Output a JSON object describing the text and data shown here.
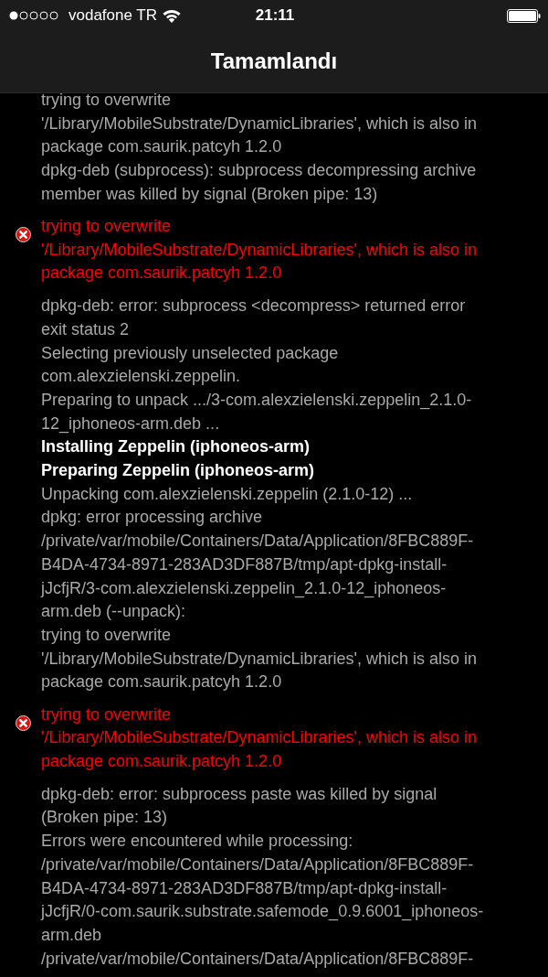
{
  "status_bar": {
    "carrier": "vodafone TR",
    "time": "21:11"
  },
  "nav_bar": {
    "title": "Tamamlandı"
  },
  "log": [
    {
      "kind": "normal",
      "lines": [
        "trying to overwrite",
        "'/Library/MobileSubstrate/DynamicLibraries', which is also in",
        "package com.saurik.patcyh 1.2.0"
      ]
    },
    {
      "kind": "normal",
      "lines": [
        "dpkg-deb (subprocess): subprocess decompressing archive",
        "member was killed by signal (Broken pipe: 13)"
      ]
    },
    {
      "kind": "error",
      "lines": [
        "trying to overwrite",
        "'/Library/MobileSubstrate/DynamicLibraries', which is also in",
        "package com.saurik.patcyh 1.2.0"
      ]
    },
    {
      "kind": "normal",
      "lines": [
        "dpkg-deb: error: subprocess <decompress> returned error",
        "exit status 2"
      ]
    },
    {
      "kind": "normal",
      "lines": [
        "Selecting previously unselected package",
        "com.alexzielenski.zeppelin."
      ]
    },
    {
      "kind": "normal",
      "lines": [
        "Preparing to unpack .../3-com.alexzielenski.zeppelin_2.1.0-",
        "12_iphoneos-arm.deb ..."
      ]
    },
    {
      "kind": "bold",
      "lines": [
        "Installing Zeppelin (iphoneos-arm)"
      ]
    },
    {
      "kind": "bold",
      "lines": [
        "Preparing Zeppelin (iphoneos-arm)"
      ]
    },
    {
      "kind": "normal",
      "lines": [
        "Unpacking com.alexzielenski.zeppelin (2.1.0-12) ..."
      ]
    },
    {
      "kind": "normal",
      "lines": [
        "dpkg: error processing archive",
        "/private/var/mobile/Containers/Data/Application/8FBC889F-",
        "B4DA-4734-8971-283AD3DF887B/tmp/apt-dpkg-install-",
        "jJcfjR/3-com.alexzielenski.zeppelin_2.1.0-12_iphoneos-",
        "arm.deb (--unpack):"
      ]
    },
    {
      "kind": "normal",
      "lines": [
        "trying to overwrite",
        "'/Library/MobileSubstrate/DynamicLibraries', which is also in",
        "package com.saurik.patcyh 1.2.0"
      ]
    },
    {
      "kind": "error",
      "lines": [
        "trying to overwrite",
        "'/Library/MobileSubstrate/DynamicLibraries', which is also in",
        "package com.saurik.patcyh 1.2.0"
      ]
    },
    {
      "kind": "normal",
      "lines": [
        "dpkg-deb: error: subprocess paste was killed by signal",
        "(Broken pipe: 13)"
      ]
    },
    {
      "kind": "normal",
      "lines": [
        "Errors were encountered while processing:"
      ]
    },
    {
      "kind": "normal",
      "lines": [
        "/private/var/mobile/Containers/Data/Application/8FBC889F-",
        "B4DA-4734-8971-283AD3DF887B/tmp/apt-dpkg-install-",
        "jJcfjR/0-com.saurik.substrate.safemode_0.9.6001_iphoneos-",
        "arm.deb"
      ]
    },
    {
      "kind": "normal",
      "lines": [
        "/private/var/mobile/Containers/Data/Application/8FBC889F-"
      ]
    }
  ]
}
